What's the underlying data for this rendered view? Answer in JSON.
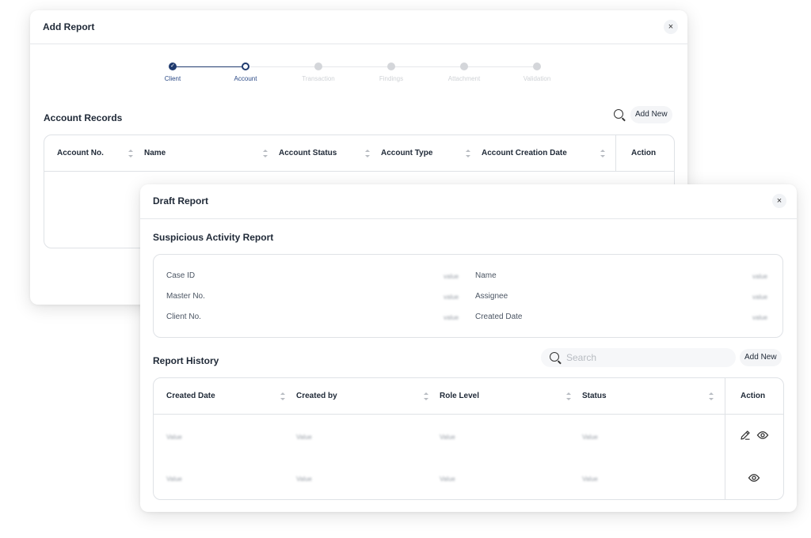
{
  "add_report": {
    "title": "Add Report",
    "close_label": "×",
    "steps": [
      {
        "label": "Client",
        "state": "done"
      },
      {
        "label": "Account",
        "state": "active"
      },
      {
        "label": "Transaction",
        "state": "pending"
      },
      {
        "label": "Findings",
        "state": "pending"
      },
      {
        "label": "Attachment",
        "state": "pending"
      },
      {
        "label": "Validation",
        "state": "pending"
      }
    ],
    "section_title": "Account Records",
    "add_new_label": "Add New",
    "columns": [
      "Account No.",
      "Name",
      "Account Status",
      "Account Type",
      "Account Creation Date",
      "Action"
    ]
  },
  "draft_report": {
    "title": "Draft Report",
    "close_label": "×",
    "sar_title": "Suspicious Activity Report",
    "info_left": [
      {
        "label": "Case ID",
        "value": "value"
      },
      {
        "label": "Master No.",
        "value": "value"
      },
      {
        "label": "Client No.",
        "value": "value"
      }
    ],
    "info_right": [
      {
        "label": "Name",
        "value": "value"
      },
      {
        "label": "Assignee",
        "value": "value"
      },
      {
        "label": "Created Date",
        "value": "value"
      }
    ],
    "history_title": "Report History",
    "search_placeholder": "Search",
    "add_new_label": "Add New",
    "columns": [
      "Created Date",
      "Created by",
      "Role Level",
      "Status",
      "Action"
    ],
    "rows": [
      {
        "cells": [
          "Value",
          "Value",
          "Value",
          "Value"
        ],
        "actions": [
          "edit",
          "view"
        ]
      },
      {
        "cells": [
          "Value",
          "Value",
          "Value",
          "Value"
        ],
        "actions": [
          "view"
        ]
      }
    ]
  },
  "colors": {
    "accent": "#1f3a6e",
    "border": "#dfe2e6",
    "step_inactive": "#d4d6da"
  }
}
